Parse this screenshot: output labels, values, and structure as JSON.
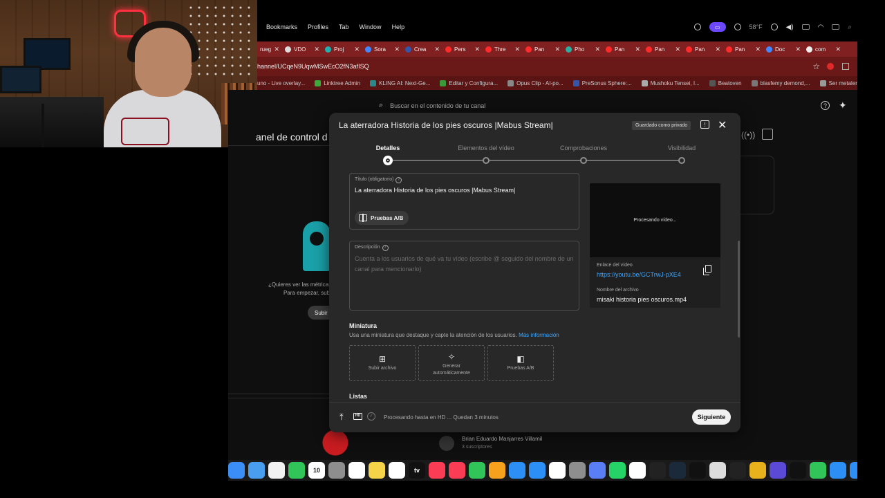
{
  "menubar": {
    "items": [
      "Bookmarks",
      "Profiles",
      "Tab",
      "Window",
      "Help"
    ],
    "temp": "58°F"
  },
  "tabs": [
    {
      "title": "rueg",
      "fav": "#777777"
    },
    {
      "title": "VDO",
      "fav": "#dddddd"
    },
    {
      "title": "Proj",
      "fav": "#20b0b0"
    },
    {
      "title": "Sora",
      "fav": "#4488ff"
    },
    {
      "title": "Crea",
      "fav": "#3355aa"
    },
    {
      "title": "Pers",
      "fav": "#ff2a2a"
    },
    {
      "title": "Thre",
      "fav": "#ff2a2a"
    },
    {
      "title": "Pan",
      "fav": "#ff2a2a"
    },
    {
      "title": "Pho",
      "fav": "#2ab0a0"
    },
    {
      "title": "Pan",
      "fav": "#ff2a2a"
    },
    {
      "title": "Pan",
      "fav": "#ff2a2a"
    },
    {
      "title": "Pan",
      "fav": "#ff2a2a"
    },
    {
      "title": "Pan",
      "fav": "#ff2a2a"
    },
    {
      "title": "Doc",
      "fav": "#4488ff"
    },
    {
      "title": "com",
      "fav": "#eeeeee"
    }
  ],
  "address": {
    "url": "hannel/UCqeN9UqwMSwEcO2fN3afISQ"
  },
  "bookmarks": [
    {
      "label": "uno - Live overlay...",
      "color": "#555555"
    },
    {
      "label": "Linktree Admin",
      "color": "#3aaa3a"
    },
    {
      "label": "KLING AI: Next-Ge...",
      "color": "#2a8a8a"
    },
    {
      "label": "Editar y Configura...",
      "color": "#3a9a3a"
    },
    {
      "label": "Opus Clip - AI-po...",
      "color": "#888888"
    },
    {
      "label": "PreSonus Sphere:...",
      "color": "#3355aa"
    },
    {
      "label": "Mushoku Tensei, I...",
      "color": "#aaaaaa"
    },
    {
      "label": "Beatoven",
      "color": "#555555"
    },
    {
      "label": "blasfemy demond,...",
      "color": "#777777"
    },
    {
      "label": "Ser metalero es bu",
      "color": "#999999"
    }
  ],
  "yt": {
    "search_placeholder": "Buscar en el contenido de tu canal",
    "page_title": "anel de control d",
    "empty_q1": "¿Quieres ver las métricas",
    "empty_q2": "Para empezar, sub",
    "upload_btn": "Subir",
    "sub_name": "Brian Eduardo Manjarres Villamil",
    "sub_count": "3 suscriptores"
  },
  "modal": {
    "title": "La aterradora Historia de los pies oscuros |Mabus Stream|",
    "saved_badge": "Guardado como privado",
    "steps": [
      {
        "label": "Detalles",
        "active": true
      },
      {
        "label": "Elementos del vídeo",
        "active": false
      },
      {
        "label": "Comprobaciones",
        "active": false
      },
      {
        "label": "Visibilidad",
        "active": false
      }
    ],
    "title_field_label": "Título (obligatorio)",
    "title_field_value": "La aterradora Historia de los pies oscuros |Mabus Stream|",
    "ab_button": "Pruebas A/B",
    "desc_label": "Descripción",
    "desc_placeholder": "Cuenta a los usuarios de qué va tu vídeo (escribe @ seguido del nombre de un canal para mencionarlo)",
    "preview_processing": "Procesando vídeo...",
    "link_label": "Enlace del vídeo",
    "link_value": "https://youtu.be/GCTrwJ-pXE4",
    "file_label": "Nombre del archivo",
    "file_value": "misaki historia pies oscuros.mp4",
    "thumb_heading": "Miniatura",
    "thumb_sub": "Usa una miniatura que destaque y capte la atención de los usuarios.",
    "thumb_more": "Más información",
    "thumb_upload": "Subir archivo",
    "thumb_generate_1": "Generar",
    "thumb_generate_2": "automáticamente",
    "thumb_ab": "Pruebas A/B",
    "lists_heading": "Listas",
    "hd_badge": "HD",
    "footer_status": "Procesando hasta en HD ... Quedan 3 minutos",
    "next_button": "Siguiente"
  },
  "dock": [
    {
      "c": "#3a8ef5",
      "t": ""
    },
    {
      "c": "#4a9ef0",
      "t": ""
    },
    {
      "c": "#f2f2f2",
      "t": ""
    },
    {
      "c": "#31c559",
      "t": ""
    },
    {
      "c": "#ffffff",
      "t": "10"
    },
    {
      "c": "#8e8e8e",
      "t": ""
    },
    {
      "c": "#ffffff",
      "t": ""
    },
    {
      "c": "#f5d44a",
      "t": ""
    },
    {
      "c": "#ffffff",
      "t": ""
    },
    {
      "c": "#111111",
      "t": "tv"
    },
    {
      "c": "#fa3c55",
      "t": ""
    },
    {
      "c": "#fa3c55",
      "t": ""
    },
    {
      "c": "#31c559",
      "t": ""
    },
    {
      "c": "#f7a21d",
      "t": ""
    },
    {
      "c": "#2b8ff5",
      "t": ""
    },
    {
      "c": "#2b8ff5",
      "t": ""
    },
    {
      "c": "#ffffff",
      "t": ""
    },
    {
      "c": "#8e8e8e",
      "t": ""
    },
    {
      "c": "#5a7ff5",
      "t": ""
    },
    {
      "c": "#25d366",
      "t": ""
    },
    {
      "c": "#ffffff",
      "t": ""
    },
    {
      "c": "#222222",
      "t": ""
    },
    {
      "c": "#1a2a3a",
      "t": ""
    },
    {
      "c": "#111111",
      "t": ""
    },
    {
      "c": "#dddddd",
      "t": ""
    },
    {
      "c": "#222222",
      "t": ""
    },
    {
      "c": "#e8b21d",
      "t": ""
    },
    {
      "c": "#5a4ad5",
      "t": ""
    },
    {
      "c": "#111111",
      "t": ""
    },
    {
      "c": "#31c559",
      "t": ""
    },
    {
      "c": "#2b8ff5",
      "t": ""
    },
    {
      "c": "#2b8ff5",
      "t": ""
    }
  ]
}
